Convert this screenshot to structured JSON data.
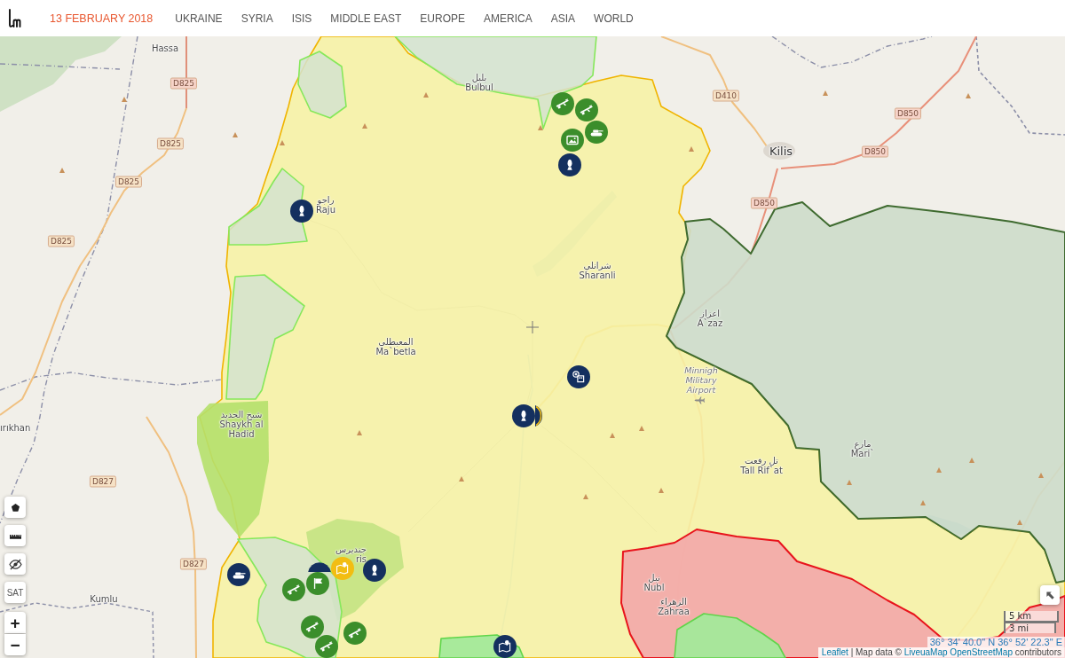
{
  "header": {
    "date": "13 FEBRUARY 2018",
    "nav": [
      "UKRAINE",
      "SYRIA",
      "ISIS",
      "MIDDLE EAST",
      "EUROPE",
      "AMERICA",
      "ASIA",
      "WORLD"
    ]
  },
  "map": {
    "places": [
      {
        "kind": "town",
        "name": "Hassa"
      },
      {
        "kind": "town",
        "native": "بلبل",
        "name": "Bulbul"
      },
      {
        "kind": "city",
        "name": "Kilis"
      },
      {
        "kind": "town",
        "native": "راجو",
        "name": "Raju"
      },
      {
        "kind": "town",
        "native": "شرانلي",
        "name": "Sharanli"
      },
      {
        "kind": "town",
        "native": "اعزاز",
        "name": "A`zaz"
      },
      {
        "kind": "town",
        "native": "المعبطلي",
        "name": "Ma`betla"
      },
      {
        "kind": "airport",
        "name": "Minnigh Military Airport"
      },
      {
        "kind": "town",
        "name": "ırıkhan"
      },
      {
        "kind": "town",
        "native": "شيخ الحديد",
        "name": "Shaykh al Hadid"
      },
      {
        "kind": "town",
        "native": "مارع",
        "name": "Mari`"
      },
      {
        "kind": "town",
        "native": "تل رفعت",
        "name": "Tall Rif`at"
      },
      {
        "kind": "town",
        "native": "جنديرس",
        "name": "ris"
      },
      {
        "kind": "town",
        "native": "نبل",
        "name": "Nubl"
      },
      {
        "kind": "town",
        "name": "Kumlu"
      },
      {
        "kind": "town",
        "native": "الزهراء",
        "name": "Zahraa"
      }
    ],
    "roads": [
      {
        "label": "D825",
        "color": "#f6d3c8"
      },
      {
        "label": "D410",
        "color": "#f6e2c6"
      },
      {
        "label": "D850",
        "color": "#f6d3c8"
      },
      {
        "label": "D825",
        "color": "#f6e2c6"
      },
      {
        "label": "D850",
        "color": "#f6d3c8"
      },
      {
        "label": "D825",
        "color": "#f6e2c6"
      },
      {
        "label": "D850",
        "color": "#f6d3c8"
      },
      {
        "label": "D825",
        "color": "#f6e2c6"
      },
      {
        "label": "D827",
        "color": "#f6e2c6"
      },
      {
        "label": "D827",
        "color": "#f6e2c6"
      }
    ],
    "markers": [
      {
        "kind": "rifle",
        "color": "#3b8e2b"
      },
      {
        "kind": "rifle",
        "color": "#3b8e2b"
      },
      {
        "kind": "tank",
        "color": "#3b8e2b"
      },
      {
        "kind": "photo",
        "color": "#3b8e2b"
      },
      {
        "kind": "bomb",
        "color": "#14305f"
      },
      {
        "kind": "bomb",
        "color": "#14305f"
      },
      {
        "kind": "building-x",
        "color": "#14305f"
      },
      {
        "kind": "ring",
        "color": "#14305f"
      },
      {
        "kind": "bomb",
        "color": "#14305f"
      },
      {
        "kind": "blank",
        "color": "#14305f"
      },
      {
        "kind": "map-pin",
        "color": "#f2bd12"
      },
      {
        "kind": "bomb",
        "color": "#14305f"
      },
      {
        "kind": "tank",
        "color": "#14305f"
      },
      {
        "kind": "rifle",
        "color": "#3b8e2b"
      },
      {
        "kind": "flag",
        "color": "#3b8e2b"
      },
      {
        "kind": "rifle",
        "color": "#3b8e2b"
      },
      {
        "kind": "rifle",
        "color": "#3b8e2b"
      },
      {
        "kind": "rifle",
        "color": "#3b8e2b"
      },
      {
        "kind": "map-pin",
        "color": "#14305f"
      }
    ],
    "controls": [
      {
        "kind": "polygon"
      },
      {
        "kind": "ruler"
      },
      {
        "kind": "hide"
      },
      {
        "kind": "satellite",
        "label": "SAT"
      },
      {
        "kind": "zoom-in",
        "label": "+"
      },
      {
        "kind": "zoom-out",
        "label": "−"
      }
    ],
    "scale": {
      "metric": "5 km",
      "imperial": "3 mi"
    },
    "coordinates": "36° 34' 40.0\" N 36° 52' 22.3\" E",
    "attribution": [
      {
        "kind": "link",
        "text": "Leaflet"
      },
      {
        "kind": "plain",
        "text": "| Map data ©"
      },
      {
        "kind": "link",
        "text": "LiveuaMap"
      },
      {
        "kind": "link",
        "text": "OpenStreetMap"
      },
      {
        "kind": "plain",
        "text": "contributors"
      }
    ]
  }
}
